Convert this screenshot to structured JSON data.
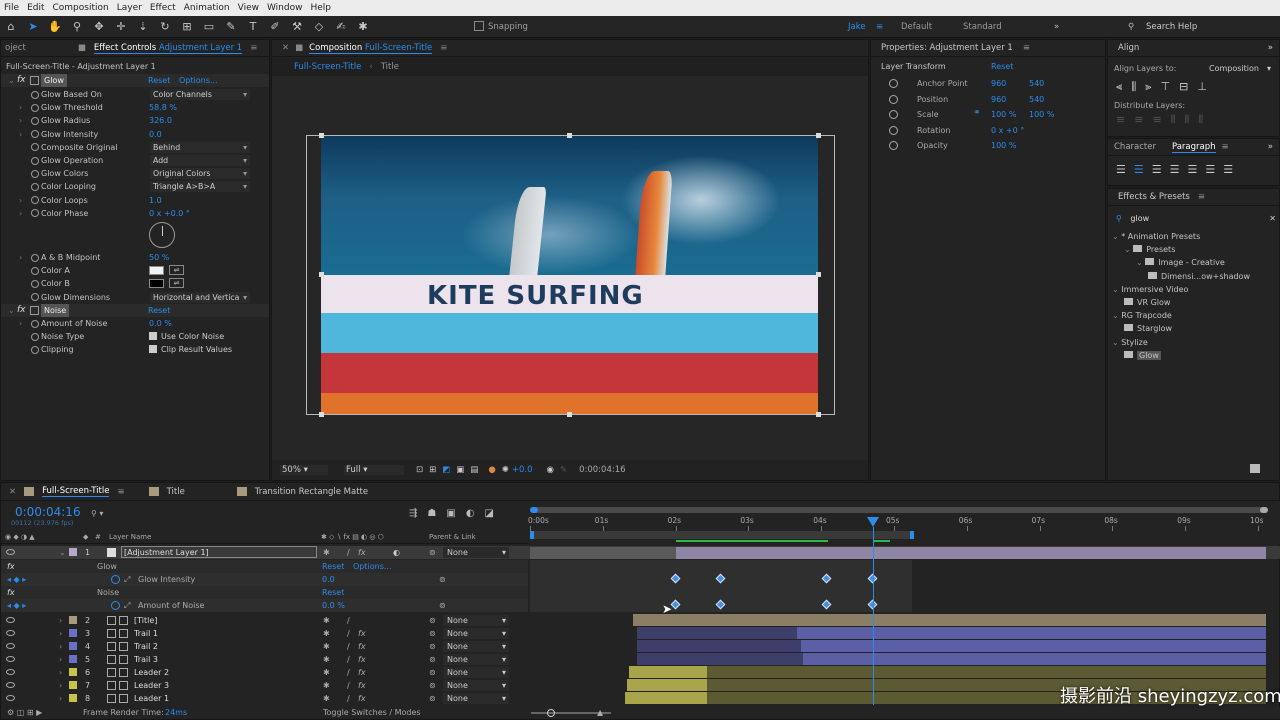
{
  "menu": [
    "File",
    "Edit",
    "Composition",
    "Layer",
    "Effect",
    "Animation",
    "View",
    "Window",
    "Help"
  ],
  "toolbar": {
    "snapping": "Snapping",
    "workspaces": [
      "Jake",
      "Default",
      "Standard"
    ],
    "search_help": "Search Help"
  },
  "effect_controls": {
    "tab_project": "oject",
    "tab_label": "Effect Controls",
    "tab_layer": "Adjustment Layer 1",
    "header": "Full-Screen-Title - Adjustment Layer 1",
    "glow": {
      "name": "Glow",
      "reset": "Reset",
      "options": "Options...",
      "rows": [
        {
          "name": "Glow Based On",
          "value": "Color Channels",
          "type": "dd"
        },
        {
          "name": "Glow Threshold",
          "value": "58.8 %",
          "type": "num"
        },
        {
          "name": "Glow Radius",
          "value": "326.0",
          "type": "num"
        },
        {
          "name": "Glow Intensity",
          "value": "0.0",
          "type": "num"
        },
        {
          "name": "Composite Original",
          "value": "Behind",
          "type": "dd"
        },
        {
          "name": "Glow Operation",
          "value": "Add",
          "type": "dd"
        },
        {
          "name": "Glow Colors",
          "value": "Original Colors",
          "type": "dd"
        },
        {
          "name": "Color Looping",
          "value": "Triangle A>B>A",
          "type": "dd"
        },
        {
          "name": "Color Loops",
          "value": "1.0",
          "type": "num"
        },
        {
          "name": "Color Phase",
          "value": "0 x +0.0 °",
          "type": "num"
        }
      ],
      "rows2": [
        {
          "name": "A & B Midpoint",
          "value": "50 %",
          "type": "num"
        },
        {
          "name": "Color A",
          "value": "",
          "type": "swatch-white"
        },
        {
          "name": "Color B",
          "value": "",
          "type": "swatch-black"
        },
        {
          "name": "Glow Dimensions",
          "value": "Horizontal and Vertica",
          "type": "dd"
        }
      ]
    },
    "noise": {
      "name": "Noise",
      "reset": "Reset",
      "rows": [
        {
          "name": "Amount of Noise",
          "value": "0.0 %",
          "type": "num"
        },
        {
          "name": "Noise Type",
          "value": "Use Color Noise",
          "type": "check"
        },
        {
          "name": "Clipping",
          "value": "Clip Result Values",
          "type": "check"
        }
      ]
    }
  },
  "composition": {
    "tab_label": "Composition",
    "tab_comp": "Full-Screen-Title",
    "crumbs": [
      "Full-Screen-Title",
      "Title"
    ],
    "title_text": "KITE SURFING",
    "zoom": "50%",
    "resolution": "Full",
    "exposure": "+0.0",
    "timecode": "0:00:04:16"
  },
  "properties": {
    "title": "Properties: Adjustment Layer 1",
    "section": "Layer Transform",
    "reset": "Reset",
    "rows": [
      {
        "name": "Anchor Point",
        "v1": "960",
        "v2": "540"
      },
      {
        "name": "Position",
        "v1": "960",
        "v2": "540"
      },
      {
        "name": "Scale",
        "v1": "100 %",
        "v2": "100 %"
      },
      {
        "name": "Rotation",
        "v1": "0 x +0 °",
        "v2": ""
      },
      {
        "name": "Opacity",
        "v1": "100 %",
        "v2": ""
      }
    ]
  },
  "align": {
    "title": "Align",
    "align_to_label": "Align Layers to:",
    "align_to": "Composition",
    "distribute": "Distribute Layers:"
  },
  "character": {
    "tab1": "Character",
    "tab2": "Paragraph"
  },
  "effects_presets": {
    "title": "Effects & Presets",
    "search": "glow",
    "tree": [
      {
        "label": "* Animation Presets",
        "indent": 0
      },
      {
        "label": "Presets",
        "indent": 1
      },
      {
        "label": "Image - Creative",
        "indent": 2
      },
      {
        "label": "Dimensi...ow+shadow",
        "indent": 3
      },
      {
        "label": "Immersive Video",
        "indent": 0
      },
      {
        "label": "VR Glow",
        "indent": 1
      },
      {
        "label": "RG Trapcode",
        "indent": 0
      },
      {
        "label": "Starglow",
        "indent": 1
      },
      {
        "label": "Stylize",
        "indent": 0
      },
      {
        "label": "Glow",
        "indent": 1
      }
    ]
  },
  "timeline": {
    "tabs": [
      "Full-Screen-Title",
      "Title",
      "Transition Rectangle Matte"
    ],
    "timecode": "0:00:04:16",
    "frames": "00112 (23.976 fps)",
    "col_layer_name": "Layer Name",
    "col_parent": "Parent & Link",
    "ruler": [
      "0:00s",
      "01s",
      "02s",
      "03s",
      "04s",
      "05s",
      "06s",
      "07s",
      "08s",
      "09s",
      "10s"
    ],
    "layers": [
      {
        "num": "1",
        "name": "[Adjustment Layer 1]",
        "parent": "None",
        "color": "#b7a8c9"
      },
      {
        "num": "2",
        "name": "[Title]",
        "parent": "None",
        "color": "#a89a7d"
      },
      {
        "num": "3",
        "name": "Trail 1",
        "parent": "None",
        "color": "#6a6fc7"
      },
      {
        "num": "4",
        "name": "Trail 2",
        "parent": "None",
        "color": "#6a6fc7"
      },
      {
        "num": "5",
        "name": "Trail 3",
        "parent": "None",
        "color": "#6a6fc7"
      },
      {
        "num": "6",
        "name": "Leader 2",
        "parent": "None",
        "color": "#c6c24a"
      },
      {
        "num": "7",
        "name": "Leader 3",
        "parent": "None",
        "color": "#c6c24a"
      },
      {
        "num": "8",
        "name": "Leader 1",
        "parent": "None",
        "color": "#c6c24a"
      }
    ],
    "glow_group": {
      "name": "Glow",
      "reset": "Reset",
      "options": "Options...",
      "prop": "Glow Intensity",
      "value": "0.0"
    },
    "noise_group": {
      "name": "Noise",
      "reset": "Reset",
      "prop": "Amount of Noise",
      "value": "0.0 %"
    },
    "render_time_label": "Frame Render Time:",
    "render_time": "24ms",
    "toggle": "Toggle Switches / Modes"
  },
  "watermark": "摄影前沿 sheyingzyz.com"
}
